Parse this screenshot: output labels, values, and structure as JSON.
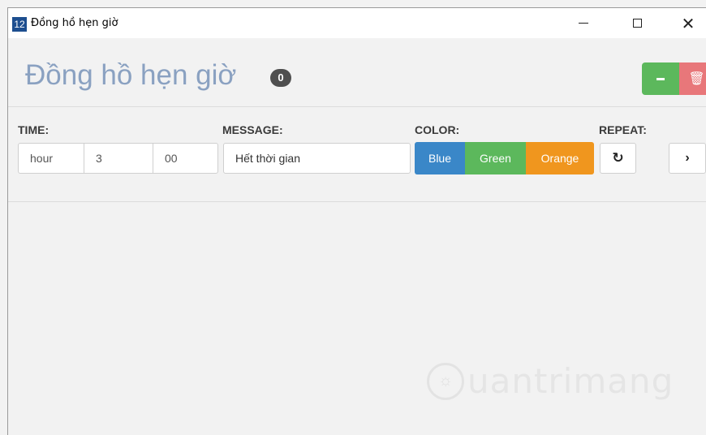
{
  "window": {
    "icon_text": "12",
    "title": "Đồng hồ hẹn giờ",
    "close_glyph": "✕"
  },
  "header": {
    "title": "Đồng hồ hẹn giờ",
    "badge_count": "0",
    "trash_glyph": "🗑"
  },
  "form": {
    "time_label": "TIME:",
    "message_label": "MESSAGE:",
    "color_label": "COLOR:",
    "repeat_label": "REPEAT:",
    "time": {
      "hour_value": "hour",
      "minutes_value": "3",
      "seconds_value": "00"
    },
    "message_value": "Hết thời gian",
    "colors": [
      {
        "label": "Blue",
        "color": "#3a87c8"
      },
      {
        "label": "Green",
        "color": "#5cb85c"
      },
      {
        "label": "Orange",
        "color": "#f0961e"
      }
    ],
    "repeat_glyph": "↻",
    "next_glyph": "›"
  },
  "watermark": {
    "icon_glyph": "☼",
    "text": "uantrimang"
  }
}
